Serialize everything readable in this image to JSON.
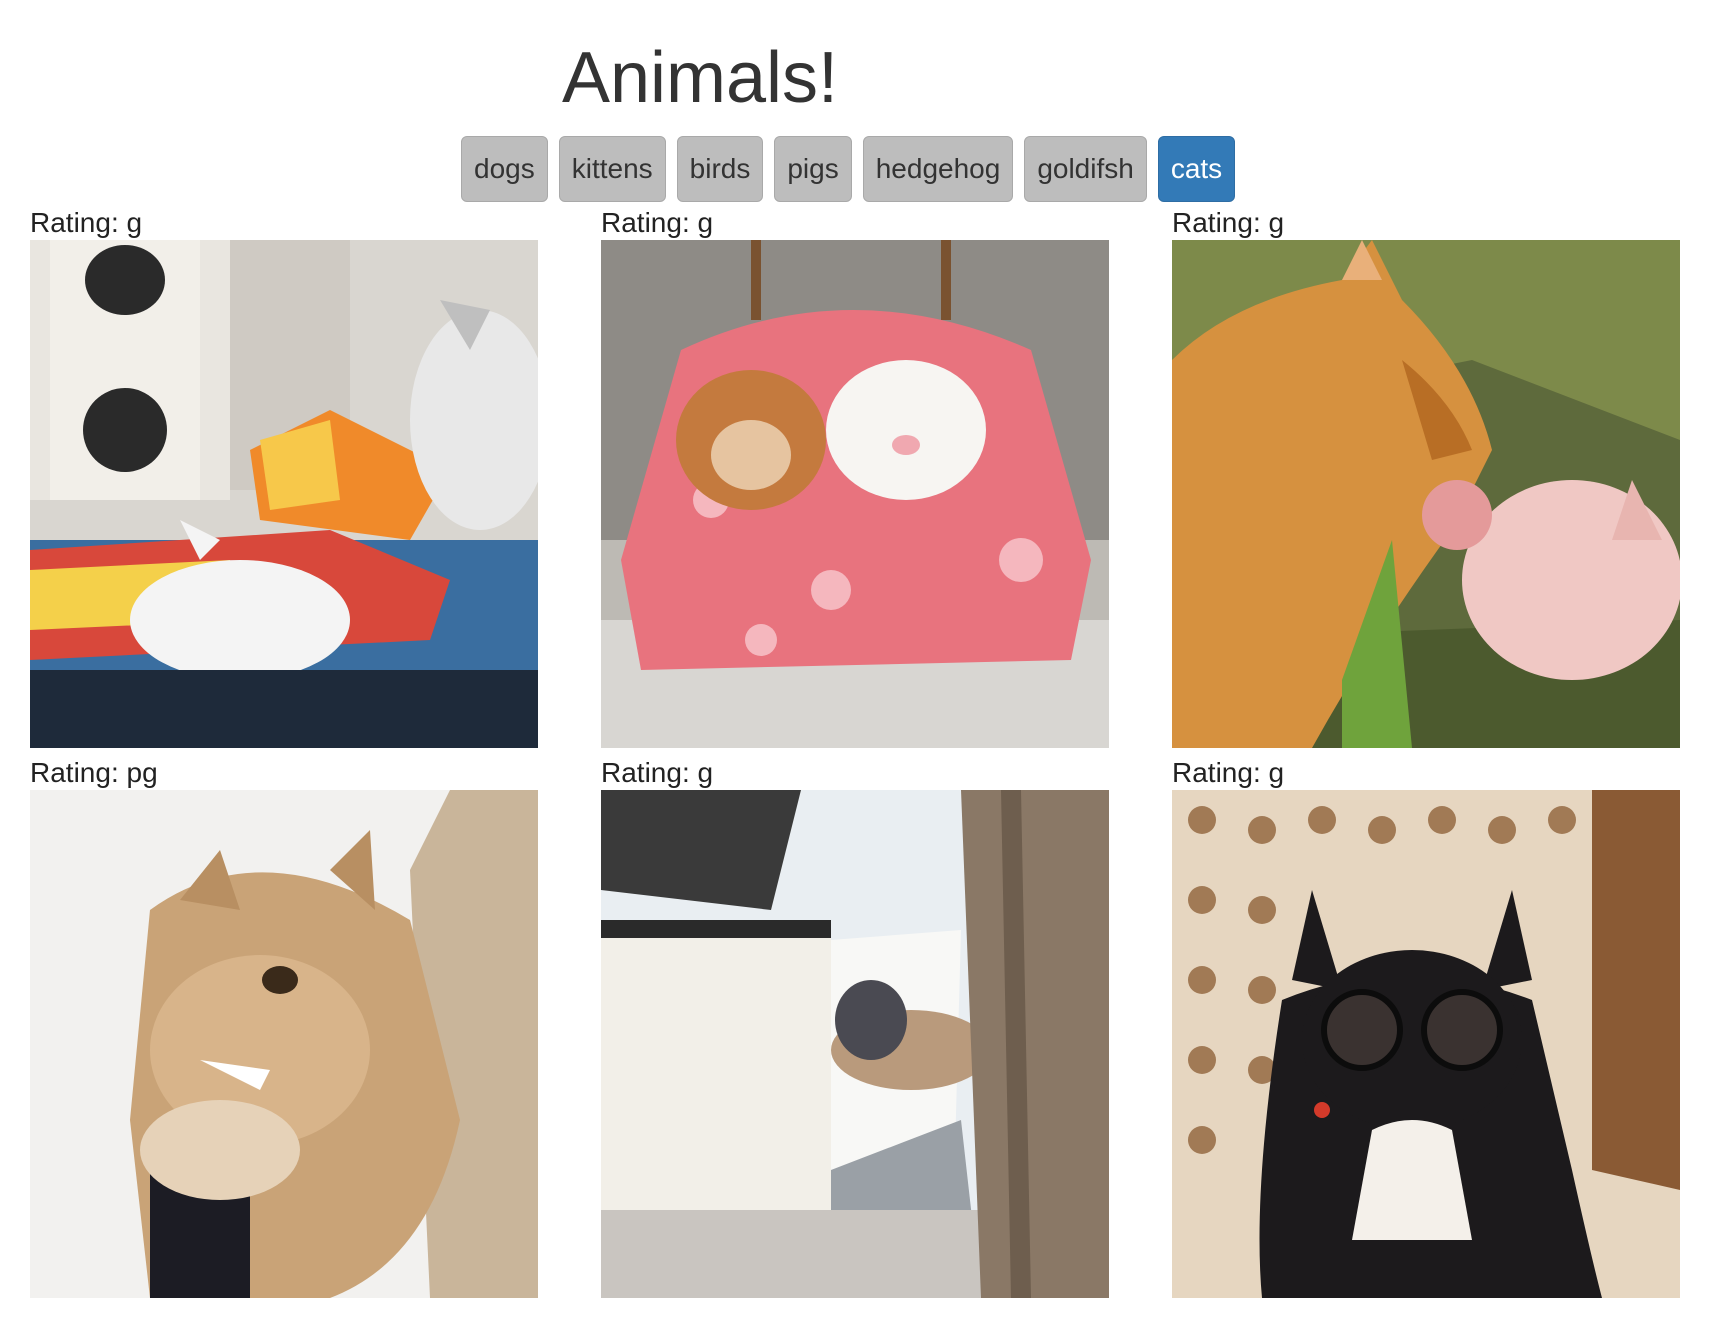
{
  "header": {
    "title": "Animals!"
  },
  "buttons": [
    {
      "label": "dogs",
      "active": false
    },
    {
      "label": "kittens",
      "active": false
    },
    {
      "label": "birds",
      "active": false
    },
    {
      "label": "pigs",
      "active": false
    },
    {
      "label": "hedgehog",
      "active": false
    },
    {
      "label": "goldifsh",
      "active": false
    },
    {
      "label": "cats",
      "active": true
    }
  ],
  "colors": {
    "active_button": "#337ab7",
    "button": "#bdbdbd"
  },
  "gifs": [
    {
      "rating": "Rating: g",
      "subject": "kittens playing"
    },
    {
      "rating": "Rating: g",
      "subject": "two cats in pink blanket"
    },
    {
      "rating": "Rating: g",
      "subject": "cat and piglet"
    },
    {
      "rating": "Rating: pg",
      "subject": "cat biting"
    },
    {
      "rating": "Rating: g",
      "subject": "siamese cat on ledge"
    },
    {
      "rating": "Rating: g",
      "subject": "cat with glasses"
    }
  ]
}
